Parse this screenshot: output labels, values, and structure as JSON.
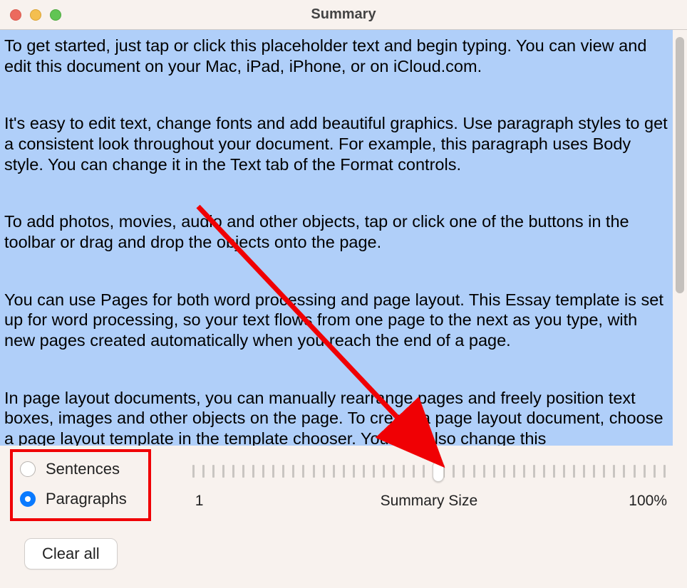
{
  "window": {
    "title": "Summary"
  },
  "content": {
    "paragraphs": [
      "To get started, just tap or click this placeholder text and begin typing.   You can view and edit this document on your Mac, iPad, iPhone, or on iCloud.com.",
      "It's easy to edit text, change fonts and add beautiful graphics.   Use paragraph styles to get a consistent look throughout your document.   For example, this paragraph uses Body style.   You can change it in the Text tab of the Format controls.",
      "To add photos, movies, audio and other objects, tap or click one of the buttons in the toolbar or drag and drop the objects onto the page.",
      "You can use Pages for both word processing and page layout.   This Essay template is set up for word processing, so your text flows from one page to the next as you type, with new pages created automatically when you reach the end of a page.",
      "In page layout documents, you can manually rearrange pages and freely position text boxes, images and other objects on the page.   To create a page layout document, choose a page layout template in the template chooser.   You can also change this"
    ]
  },
  "controls": {
    "mode": {
      "options": [
        "Sentences",
        "Paragraphs"
      ],
      "selected": "Paragraphs"
    },
    "slider": {
      "min_label": "1",
      "center_label": "Summary Size",
      "max_label": "100%",
      "value_percent": 52
    },
    "clear_label": "Clear all"
  }
}
